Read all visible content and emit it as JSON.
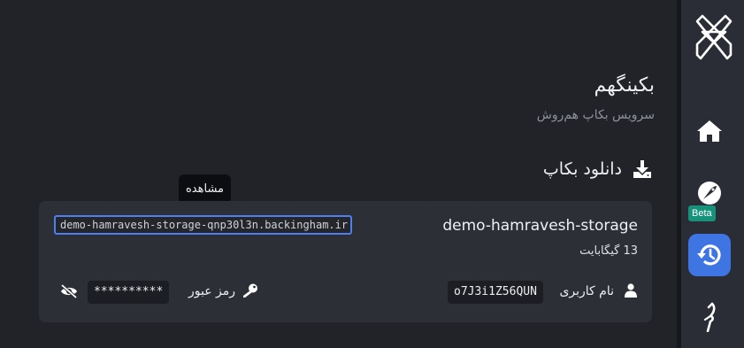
{
  "sidebar": {
    "beta_badge": "Beta",
    "items": [
      {
        "icon": "home-icon"
      },
      {
        "icon": "rocket-icon"
      },
      {
        "icon": "history-icon",
        "active": true
      },
      {
        "icon": "feather-icon"
      }
    ]
  },
  "header": {
    "title": "بکینگهم",
    "subtitle": "سرویس بکاپ هم‌روش"
  },
  "section": {
    "title": "دانلود بکاپ",
    "icon": "download-icon"
  },
  "tooltip": {
    "text": "مشاهده"
  },
  "backup": {
    "url": "demo-hamravesh-storage-qnp30l3n.backingham.ir",
    "name": "demo-hamravesh-storage",
    "size": "13 گیگابایت",
    "username_label": "نام کاربری",
    "username": "o7J3i1Z56QUN",
    "password_label": "رمز عبور",
    "password_masked": "**********"
  },
  "colors": {
    "background": "#212329",
    "sidebar": "#2a2d35",
    "card": "#2c2f36",
    "accent": "#3f74e3",
    "beta": "#16917a"
  }
}
